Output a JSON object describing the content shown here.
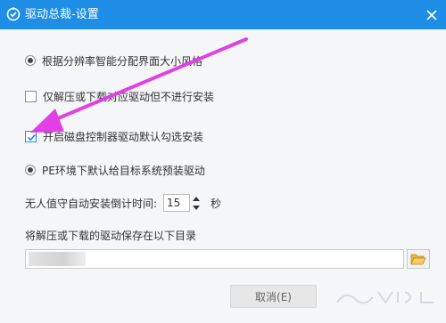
{
  "window": {
    "title": "驱动总裁-设置",
    "accent": "#1e8ee6"
  },
  "options": {
    "auto_size": {
      "label": "根据分辨率智能分配界面大小风格",
      "selected": true
    },
    "extract_only": {
      "label": "仅解压或下载对应驱动但不进行安装",
      "checked": false
    },
    "disk_controller": {
      "label": "开启磁盘控制器驱动默认勾选安装",
      "checked": true
    },
    "pe_preinstall": {
      "label": "PE环境下默认给目标系统预装驱动",
      "selected": true
    }
  },
  "countdown": {
    "label": "无人值守自动安装倒计时间:",
    "value": "15",
    "unit": "秒"
  },
  "save_dir": {
    "label": "将解压或下载的驱动保存在以下目录",
    "value": ""
  },
  "buttons": {
    "cancel": "取消(E)"
  },
  "annotation": {
    "arrow_color": "#e040e6"
  }
}
